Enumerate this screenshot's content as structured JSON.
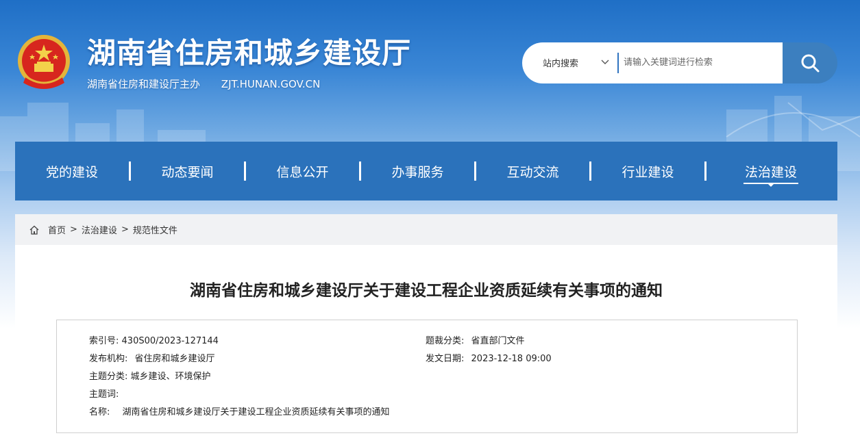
{
  "header": {
    "site_title": "湖南省住房和城乡建设厅",
    "sponsor": "湖南省住房和建设厅主办",
    "domain": "ZJT.HUNAN.GOV.CN"
  },
  "search": {
    "scope": "站内搜索",
    "placeholder": "请输入关键词进行检索",
    "icon": "search-icon"
  },
  "nav": {
    "items": [
      {
        "label": "党的建设"
      },
      {
        "label": "动态要闻"
      },
      {
        "label": "信息公开"
      },
      {
        "label": "办事服务"
      },
      {
        "label": "互动交流"
      },
      {
        "label": "行业建设"
      },
      {
        "label": "法治建设",
        "active": true
      }
    ]
  },
  "breadcrumb": {
    "home": "首页",
    "level1": "法治建设",
    "level2": "规范性文件",
    "separator": ">"
  },
  "article": {
    "title": "湖南省住房和城乡建设厅关于建设工程企业资质延续有关事项的通知",
    "meta": {
      "index_label": "索引号:",
      "index_value": "430S00/2023-127144",
      "category_label": "题裁分类:",
      "category_value": "省直部门文件",
      "publisher_label": "发布机构:",
      "publisher_value": "省住房和城乡建设厅",
      "date_label": "发文日期:",
      "date_value": "2023-12-18 09:00",
      "topic_label": "主题分类:",
      "topic_value": "城乡建设、环境保护",
      "keywords_label": "主题词:",
      "keywords_value": "",
      "name_label": "名称:",
      "name_value": "湖南省住房和城乡建设厅关于建设工程企业资质延续有关事项的通知"
    }
  },
  "colors": {
    "nav_bg": "#2b72bb",
    "search_btn": "#3c7fbf",
    "accent": "#2f73c0"
  }
}
